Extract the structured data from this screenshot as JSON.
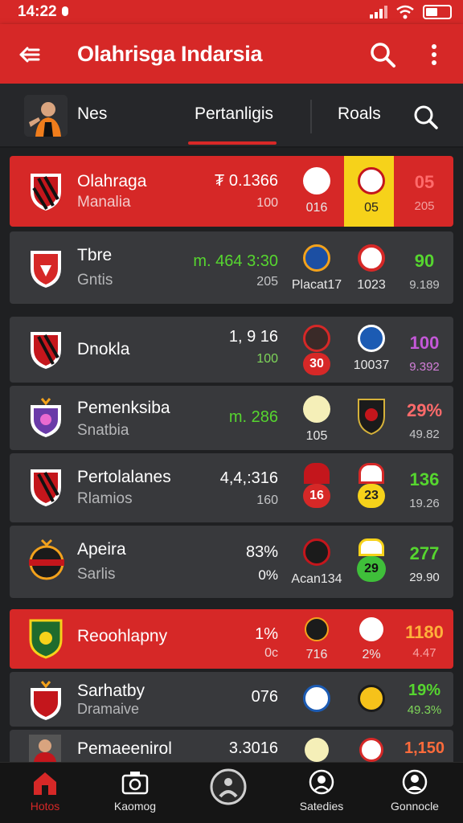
{
  "status_bar": {
    "time": "14:22"
  },
  "app_bar": {
    "title": "Olahrisga Indarsia"
  },
  "tabs": [
    {
      "label": "Nes"
    },
    {
      "label": "Pertanligis"
    },
    {
      "label": "Roals"
    }
  ],
  "rows": [
    {
      "name": "Olahraga",
      "sub": "Manalia",
      "val1": "₮ 0.1366",
      "val2": "100",
      "a_label": "016",
      "b_label": "05",
      "c_pct": "05",
      "c_sub": "205"
    },
    {
      "name": "Tbre",
      "sub": "Gntis",
      "val1": "m. 464 3:30",
      "val2": "205",
      "a_label": "Placat17",
      "b_label": "1023",
      "c_pct": "90",
      "c_sub": "9.189"
    },
    {
      "name": "Dnokla",
      "sub": "",
      "val1": "1, 9 16",
      "val2": "100",
      "a_label": "30",
      "b_label": "10037",
      "c_pct": "100",
      "c_sub": "9.392"
    },
    {
      "name": "Pemenksiba",
      "sub": "Snatbia",
      "val1": "m. 286",
      "val2": "",
      "a_label": "105",
      "b_label": "",
      "c_pct": "29%",
      "c_sub": "49.82"
    },
    {
      "name": "Pertolalanes",
      "sub": "Rlamios",
      "val1": "4,4,:316",
      "val2": "160",
      "a_label": "16",
      "b_label": "23",
      "c_pct": "136",
      "c_sub": "19.26"
    },
    {
      "name": "Apeira",
      "sub": "Sarlis",
      "val1": "83%",
      "val2": "0%",
      "a_label": "Acan134",
      "b_label": "29",
      "c_pct": "277",
      "c_sub": "29.90"
    },
    {
      "name": "Reoohlapny",
      "sub": "",
      "val1": "1%",
      "val2": "0c",
      "a_label": "716",
      "b_label": "2%",
      "c_pct": "1180",
      "c_sub": "4.47"
    },
    {
      "name": "Sarhatby",
      "sub": "Dramaive",
      "val1": "076",
      "val2": "",
      "a_label": "",
      "b_label": "",
      "c_pct": "19%",
      "c_sub": "49.3%"
    },
    {
      "name": "Pemaeenirol",
      "sub": "",
      "val1": "3.3016",
      "val2": "",
      "a_label": "",
      "b_label": "",
      "c_pct": "1,150",
      "c_sub": ""
    }
  ],
  "bottom_nav": [
    {
      "label": "Hotos"
    },
    {
      "label": "Kaomog"
    },
    {
      "label": ""
    },
    {
      "label": "Satedies"
    },
    {
      "label": "Gonnocle"
    }
  ],
  "colors": {
    "brand_red": "#d62827",
    "row_bg": "#38393c",
    "positive": "#56d62f"
  }
}
